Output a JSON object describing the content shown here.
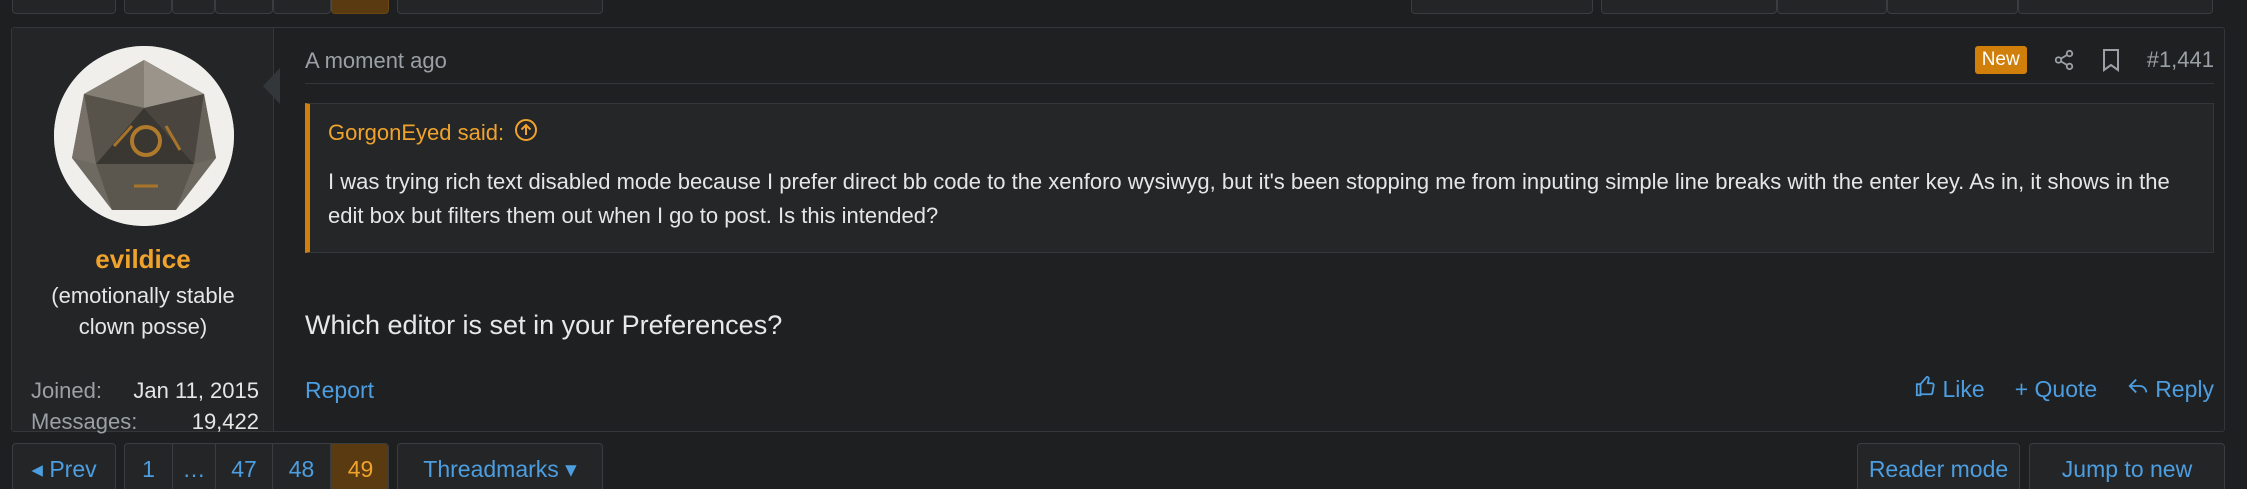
{
  "post": {
    "user": {
      "username": "evildice",
      "user_title": "(emotionally stable clown posse)",
      "joined_label": "Joined:",
      "joined_value": "Jan 11, 2015",
      "messages_label": "Messages:",
      "messages_value": "19,422"
    },
    "date": "A moment ago",
    "badge_new": "New",
    "post_number": "#1,441",
    "quote": {
      "author_said": "GorgonEyed said:",
      "text": "I was trying rich text disabled mode because I prefer direct bb code to the xenforo wysiwyg, but it's been stopping me from inputing simple line breaks with the enter key. As in, it shows in the edit box but filters them out when I go to post. Is this intended?"
    },
    "message": "Which editor is set in your Preferences?",
    "report_label": "Report",
    "actions": {
      "like": "Like",
      "quote": "+ Quote",
      "reply": "Reply"
    }
  },
  "page_nav": {
    "prev": "Prev",
    "pages": [
      "1",
      "…",
      "47",
      "48",
      "49"
    ],
    "current_page": "49",
    "threadmarks": "Threadmarks",
    "reader_mode": "Reader mode",
    "jump_to_new": "Jump to new"
  },
  "colors": {
    "accent": "#f0a32c",
    "link": "#4d9ee0",
    "new_badge": "#d07f0a",
    "background": "#1d1f21"
  }
}
